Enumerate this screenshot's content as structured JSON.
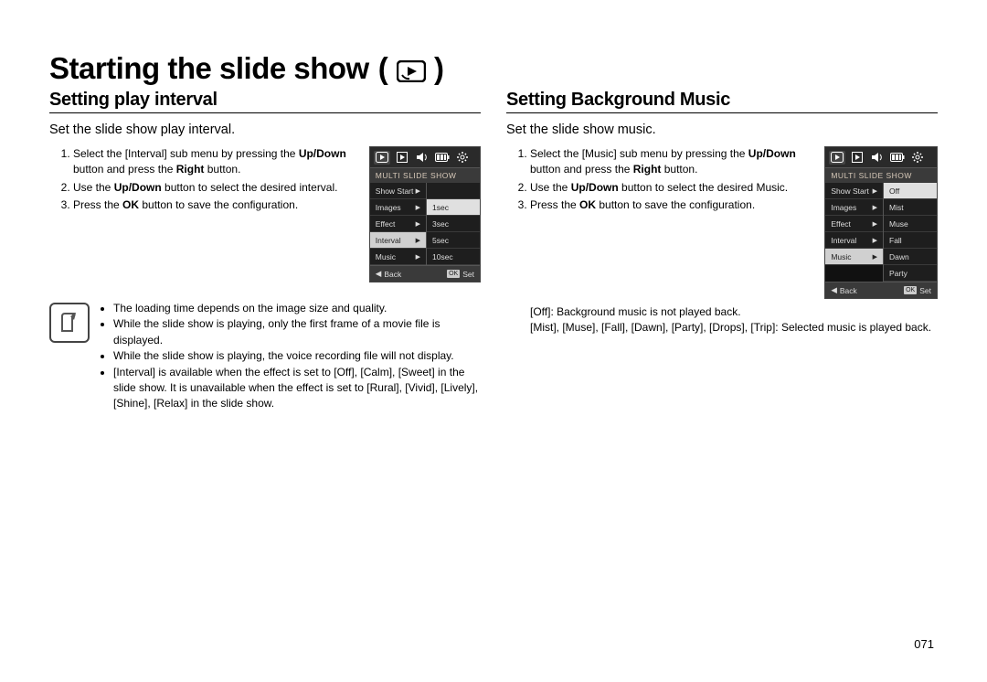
{
  "title": "Starting the slide show",
  "pageNumber": "071",
  "left": {
    "heading": "Setting play interval",
    "lead": "Set the slide show play interval.",
    "steps": {
      "s1_a": "Select the [Interval] sub menu by pressing the ",
      "s1_b": "Up/Down",
      "s1_c": " button and press the ",
      "s1_d": "Right",
      "s1_e": " button.",
      "s2_a": "Use the ",
      "s2_b": "Up/Down",
      "s2_c": " button to select the desired interval.",
      "s3_a": "Press the ",
      "s3_b": "OK",
      "s3_c": " button to save the configuration."
    },
    "notes": [
      "The loading time depends on the image size and quality.",
      "While the slide show is playing, only the first frame of a movie file is displayed.",
      "While the slide show is playing, the voice recording file will not display.",
      "[Interval] is available when the effect is set to [Off], [Calm], [Sweet] in the slide show. It is unavailable when the effect is set to [Rural], [Vivid], [Lively], [Shine], [Relax] in the slide show."
    ],
    "screen": {
      "header": "MULTI SLIDE SHOW",
      "menu": [
        "Show Start",
        "Images",
        "Effect",
        "Interval",
        "Music"
      ],
      "highlight": "Interval",
      "options": [
        "1sec",
        "3sec",
        "5sec",
        "10sec"
      ],
      "optHighlight": "1sec",
      "footerBack": "Back",
      "footerOk": "OK",
      "footerSet": "Set"
    }
  },
  "right": {
    "heading": "Setting Background Music",
    "lead": "Set the slide show music.",
    "steps": {
      "s1_a": "Select the [Music] sub menu by pressing the ",
      "s1_b": "Up/Down",
      "s1_c": " button and press the ",
      "s1_d": "Right",
      "s1_e": " button.",
      "s2_a": "Use the ",
      "s2_b": "Up/Down",
      "s2_c": " button to select the desired Music.",
      "s3_a": "Press the ",
      "s3_b": "OK",
      "s3_c": " button to save the configuration."
    },
    "musicNotes": [
      "[Off]: Background music is not played back.",
      "[Mist], [Muse], [Fall], [Dawn], [Party], [Drops], [Trip]: Selected music is played back."
    ],
    "screen": {
      "header": "MULTI SLIDE SHOW",
      "menu": [
        "Show Start",
        "Images",
        "Effect",
        "Interval",
        "Music"
      ],
      "highlight": "Music",
      "options": [
        "Off",
        "Mist",
        "Muse",
        "Fall",
        "Dawn",
        "Party"
      ],
      "optHighlight": "Off",
      "footerBack": "Back",
      "footerOk": "OK",
      "footerSet": "Set"
    }
  }
}
